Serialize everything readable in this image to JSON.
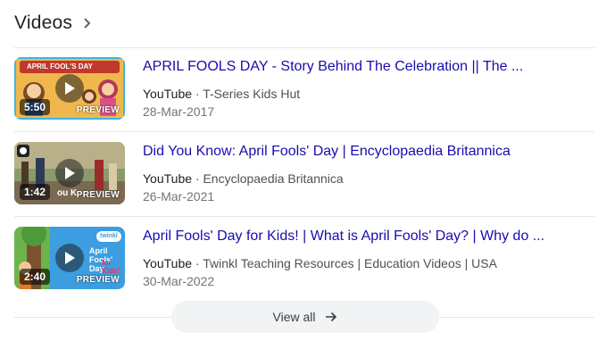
{
  "header": {
    "title": "Videos",
    "chevron_icon": "chevron-right-icon"
  },
  "videos": [
    {
      "title": "APRIL FOOLS DAY - Story Behind The Celebration || The ...",
      "source": "YouTube",
      "channel": "T-Series Kids Hut",
      "date": "28-Mar-2017",
      "duration": "5:50",
      "preview_label": "PREVIEW",
      "thumb_caption": "APRIL FOOL'S DAY"
    },
    {
      "title": "Did You Know: April Fools' Day | Encyclopaedia Britannica",
      "source": "YouTube",
      "channel": "Encyclopaedia Britannica",
      "date": "26-Mar-2021",
      "duration": "1:42",
      "preview_label": "PREVIEW",
      "thumb_caption": "ou K"
    },
    {
      "title": "April Fools' Day for Kids! | What is April Fools' Day? | Why do ...",
      "source": "YouTube",
      "channel": "Twinkl Teaching Resources | Education Videos | USA",
      "date": "30-Mar-2022",
      "duration": "2:40",
      "preview_label": "PREVIEW",
      "thumb_caption": "April Fools' Day",
      "thumb_caption_2": "for Kids!",
      "thumb_badge": "twinkl"
    }
  ],
  "separator": " · ",
  "view_all": {
    "label": "View all",
    "icon": "arrow-right-icon"
  },
  "colors": {
    "link": "#1a0dab",
    "thumb1": "#e8a63a",
    "thumb2": "#6b7a55",
    "thumb3": "#3c9ee0"
  }
}
